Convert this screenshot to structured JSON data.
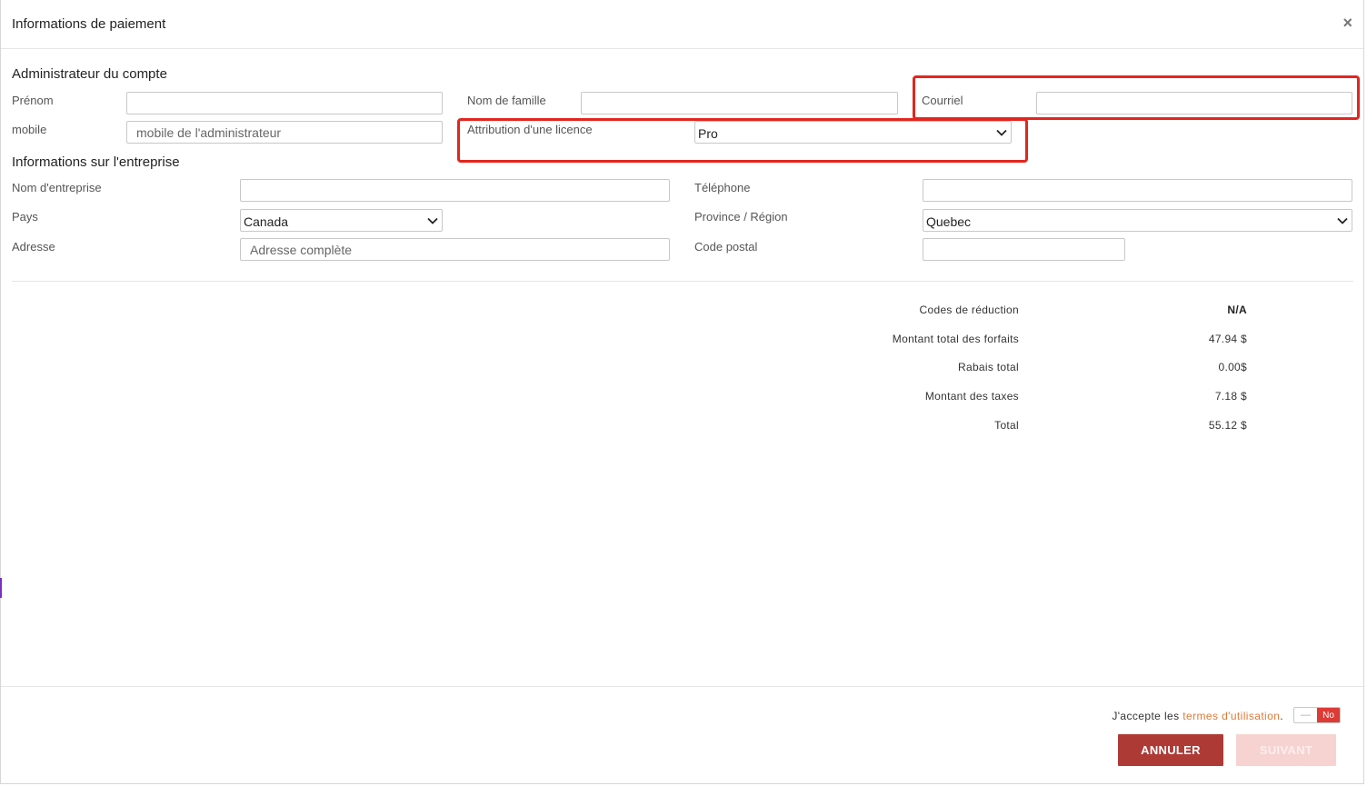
{
  "header": {
    "title": "Informations de paiement",
    "close_glyph": "×"
  },
  "admin": {
    "title": "Administrateur du compte",
    "first_name_label": "Prénom",
    "first_name_value": "",
    "last_name_label": "Nom de famille",
    "last_name_value": "",
    "email_label": "Courriel",
    "email_value": "",
    "mobile_label": "mobile",
    "mobile_placeholder": "mobile de l'administrateur",
    "license_label": "Attribution d'une licence",
    "license_value": "Pro"
  },
  "company": {
    "title": "Informations sur l'entreprise",
    "name_label": "Nom d'entreprise",
    "name_value": "",
    "phone_label": "Téléphone",
    "phone_value": "",
    "country_label": "Pays",
    "country_value": "Canada",
    "province_label": "Province / Région",
    "province_value": "Quebec",
    "address_label": "Adresse",
    "address_placeholder": "Adresse complète",
    "postal_label": "Code postal",
    "postal_value": ""
  },
  "summary": [
    {
      "label": "Codes de réduction",
      "value": "N/A"
    },
    {
      "label": "Montant total des forfaits",
      "value": "47.94 $"
    },
    {
      "label": "Rabais total",
      "value": "0.00$"
    },
    {
      "label": "Montant des taxes",
      "value": "7.18 $"
    },
    {
      "label": "Total",
      "value": "55.12 $"
    }
  ],
  "footer": {
    "terms_prefix": "J'accepte les ",
    "terms_link": "termes d'utilisation",
    "terms_suffix": ".",
    "toggle_off": "—",
    "toggle_label": "No",
    "cancel_label": "ANNULER",
    "next_label": "SUIVANT"
  },
  "colors": {
    "highlight": "#e2261f",
    "primary_button": "#ae3a36",
    "disabled_button": "#f6d3d0",
    "link": "#e07b39",
    "toggle_no": "#dc3b36"
  }
}
